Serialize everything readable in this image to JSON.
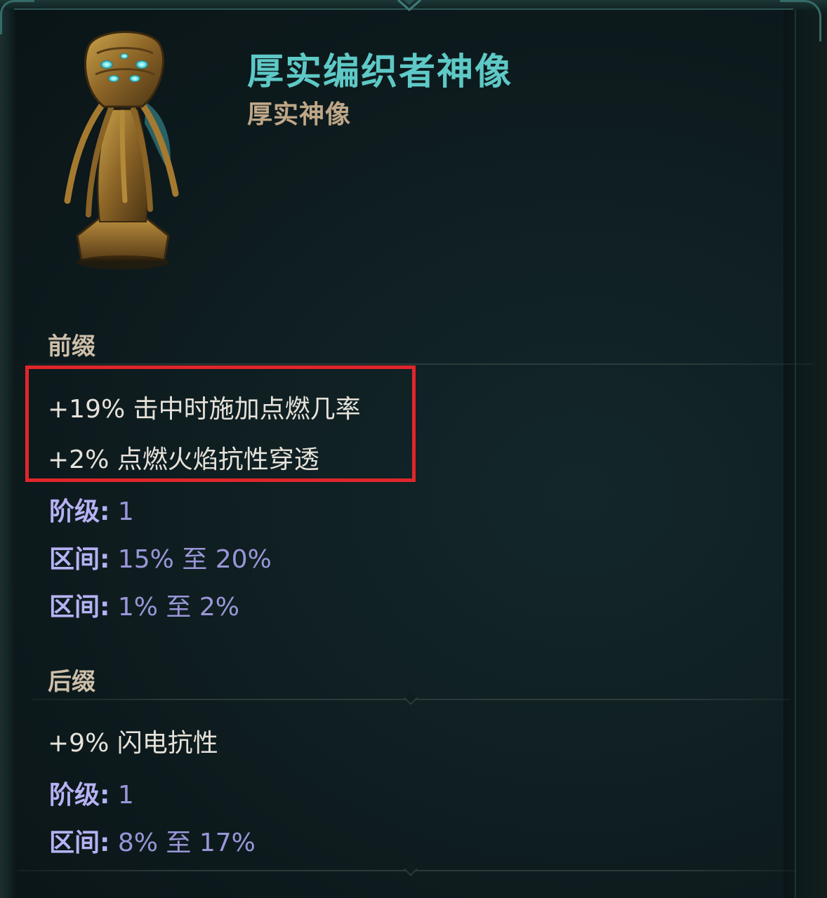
{
  "item": {
    "name": "厚实编织者神像",
    "type": "厚实神像",
    "icon": "weaver-idol-statue-icon"
  },
  "prefix": {
    "label": "前缀",
    "mods": [
      "+19% 击中时施加点燃几率",
      "+2% 点燃火焰抗性穿透"
    ],
    "tier_key": "阶级:",
    "tier_value": "1",
    "ranges": [
      {
        "key": "区间:",
        "value": "15% 至 20%"
      },
      {
        "key": "区间:",
        "value": "1% 至 2%"
      }
    ]
  },
  "suffix": {
    "label": "后缀",
    "mods": [
      "+9% 闪电抗性"
    ],
    "tier_key": "阶级:",
    "tier_value": "1",
    "ranges": [
      {
        "key": "区间:",
        "value": "8% 至 17%"
      }
    ]
  },
  "colors": {
    "title": "#5ec9c6",
    "subtitle": "#bfa788",
    "stat_key": "#b6b2f4",
    "stat_value": "#9a96d8",
    "highlight": "#e0262b"
  }
}
